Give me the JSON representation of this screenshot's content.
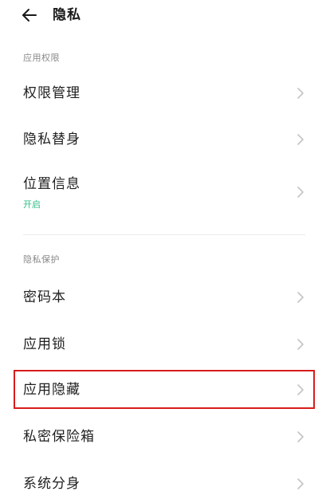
{
  "header": {
    "back_icon": "back-arrow-icon",
    "title": "隐私"
  },
  "sections": [
    {
      "title": "应用权限",
      "items": [
        {
          "label": "权限管理",
          "icon": "chevron-right-icon"
        },
        {
          "label": "隐私替身",
          "icon": "chevron-right-icon"
        },
        {
          "label": "位置信息",
          "sub": "开启",
          "icon": "chevron-right-icon"
        }
      ]
    },
    {
      "title": "隐私保护",
      "items": [
        {
          "label": "密码本",
          "icon": "chevron-right-icon"
        },
        {
          "label": "应用锁",
          "icon": "chevron-right-icon"
        },
        {
          "label": "应用隐藏",
          "icon": "chevron-right-icon",
          "highlighted": true
        },
        {
          "label": "私密保险箱",
          "icon": "chevron-right-icon"
        },
        {
          "label": "系统分身",
          "icon": "chevron-right-icon"
        }
      ]
    }
  ],
  "colors": {
    "status_on": "#2fbf86",
    "highlight_border": "#d81c1c",
    "chevron": "#c4c4c4"
  }
}
